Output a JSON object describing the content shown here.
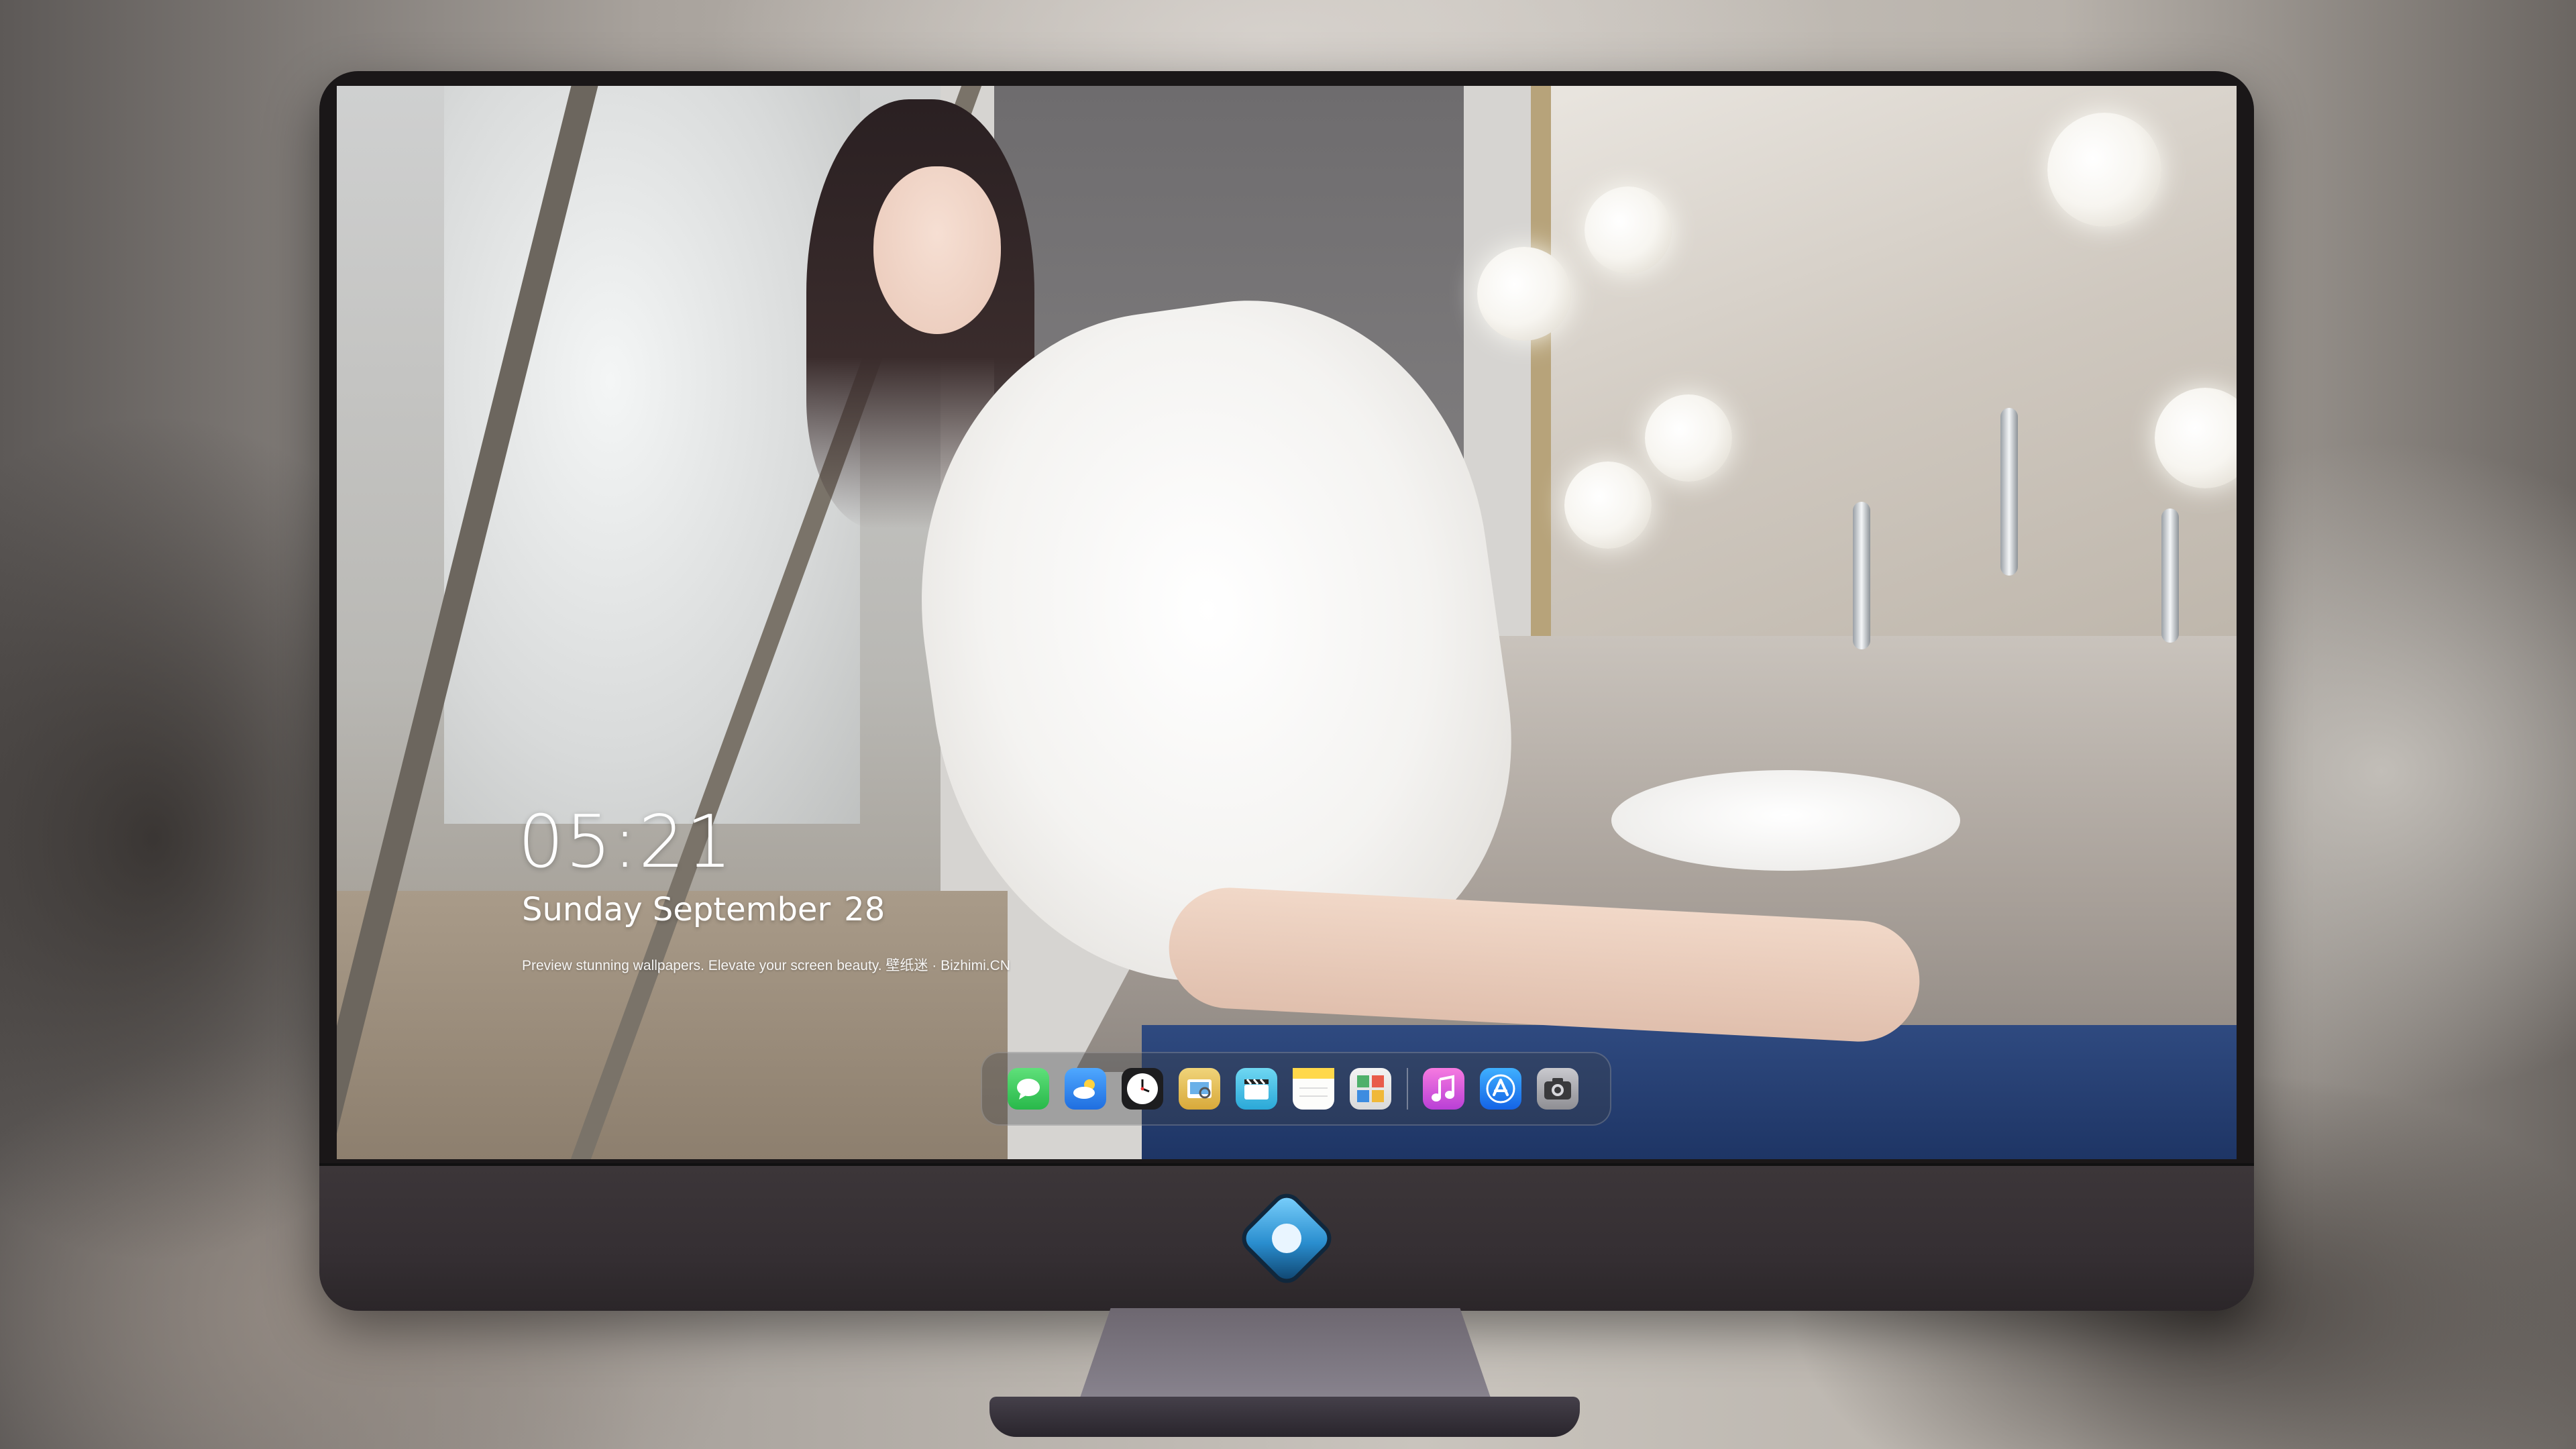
{
  "lock_screen": {
    "time": "05:21",
    "weekday_month": "Sunday September",
    "day": "28",
    "tagline": "Preview stunning wallpapers. Elevate your screen beauty. 壁纸迷 · Bizhimi.CN"
  },
  "dock": {
    "apps": [
      {
        "name": "messages-icon",
        "color": "#34c759",
        "glyph": "●"
      },
      {
        "name": "weather-icon",
        "color": "#2f8cf6",
        "glyph": "☁"
      },
      {
        "name": "clock-icon",
        "color": "#f2f2f2",
        "glyph": "🕐"
      },
      {
        "name": "preview-icon",
        "color": "#e8c15a",
        "glyph": "▣"
      },
      {
        "name": "clips-icon",
        "color": "#45c3e8",
        "glyph": "🎬"
      },
      {
        "name": "notes-icon",
        "color": "#ffd84a",
        "glyph": "≡"
      },
      {
        "name": "photo-booth-icon",
        "color": "#4fb06b",
        "glyph": "▦"
      },
      {
        "name": "music-icon",
        "color": "#e74fd0",
        "glyph": "♫"
      },
      {
        "name": "app-store-icon",
        "color": "#1f8cf5",
        "glyph": "A"
      },
      {
        "name": "camera-icon",
        "color": "#8d8d92",
        "glyph": "◉"
      }
    ]
  },
  "brand": {
    "logo": "dragon-badge-icon"
  }
}
